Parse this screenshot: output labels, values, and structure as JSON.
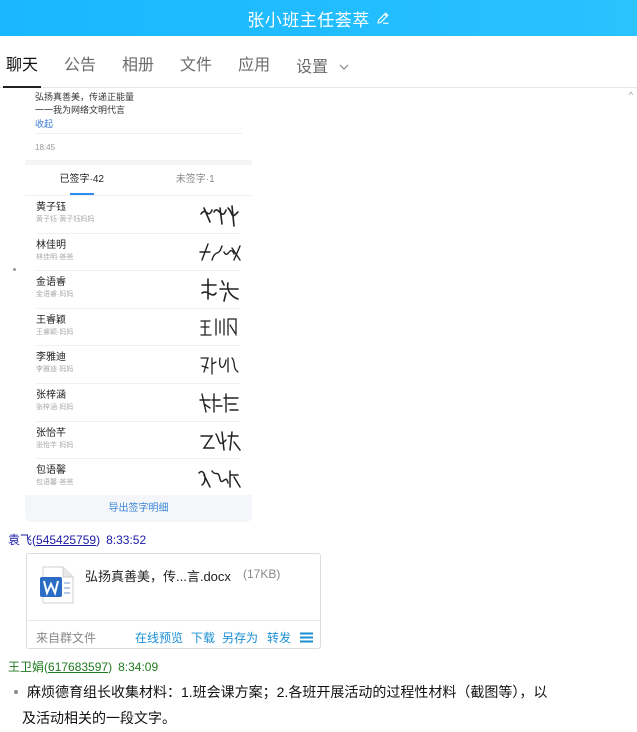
{
  "window": {
    "title": "张小班主任荟萃",
    "edit_icon": "pencil-icon"
  },
  "tabs": [
    {
      "label": "聊天",
      "active": true
    },
    {
      "label": "公告"
    },
    {
      "label": "相册"
    },
    {
      "label": "文件"
    },
    {
      "label": "应用"
    },
    {
      "label": "设置",
      "has_dropdown": true
    }
  ],
  "scroll_glyph": "^",
  "sign_card": {
    "notice_lines": [
      "弘扬真善美，传递正能量",
      "一一我为网络文明代言"
    ],
    "collapse": "收起",
    "time": "18:45",
    "tab_signed": "已签字·42",
    "tab_unsigned": "未签字·1",
    "rows": [
      {
        "name": "黄子钰",
        "sub": "黄子钰·黄子钰妈妈",
        "signature": "黄成芽"
      },
      {
        "name": "林佳明",
        "sub": "林佳明·爸爸",
        "signature": "林佳明"
      },
      {
        "name": "金语睿",
        "sub": "金语睿·妈妈",
        "signature": "黄浩"
      },
      {
        "name": "王睿颖",
        "sub": "王睿颖·妈妈",
        "signature": "王小凤"
      },
      {
        "name": "李雅迪",
        "sub": "李雅迪·妈妈",
        "signature": "孙娜"
      },
      {
        "name": "张梓涵",
        "sub": "张梓涵·妈妈",
        "signature": "解佳佳"
      },
      {
        "name": "张怡芊",
        "sub": "张怡芊·妈妈",
        "signature": "王飞珠"
      },
      {
        "name": "包语馨",
        "sub": "包语馨·爸爸",
        "signature": "翁丽萍"
      }
    ],
    "export_label": "导出签字明细"
  },
  "messages": [
    {
      "sender": "袁飞",
      "qq": "545425759",
      "time": "8:33:52",
      "color": "#1a1aa6",
      "file": {
        "name": "弘扬真善美，传...言.docx",
        "size": "(17KB)",
        "from": "来自群文件",
        "actions": [
          "在线预览",
          "下载",
          "另存为",
          "转发"
        ],
        "icon": "word-doc-icon"
      }
    },
    {
      "sender": "王卫娟",
      "qq": "617683597",
      "time": "8:34:09",
      "color": "#1f7a1f",
      "text_line1": "麻烦德育组长收集材料：1.班会课方案；2.各班开展活动的过程性材料（截图等），以",
      "text_line2": "及活动相关的一段文字。"
    }
  ],
  "colors": {
    "accent": "#1aa3ff",
    "link": "#1a8fd6",
    "sender1": "#1a1aa6",
    "sender2": "#1f7a1f"
  }
}
